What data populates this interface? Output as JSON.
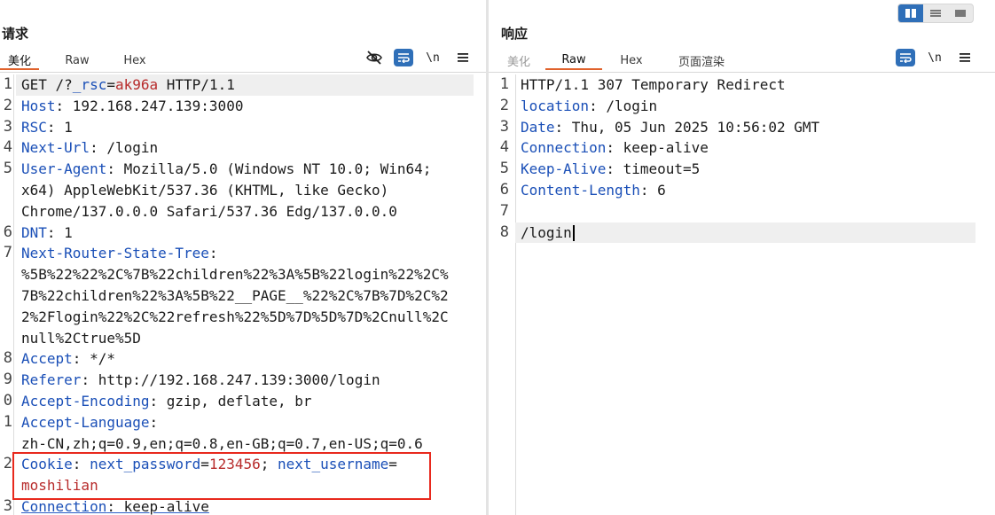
{
  "view_toggle": {
    "modes": [
      "split-columns",
      "split-rows",
      "single"
    ],
    "active": "split-columns"
  },
  "request": {
    "title": "请求",
    "tabs": [
      {
        "label": "美化",
        "active": true
      },
      {
        "label": "Raw",
        "active": false
      },
      {
        "label": "Hex",
        "active": false
      }
    ],
    "toolbar": {
      "hide_icon": "eye-off-icon",
      "wrap_icon": "wrap-icon",
      "newline_label": "\\n",
      "menu_icon": "menu-icon"
    },
    "rows": [
      {
        "no": "1",
        "hl": true,
        "parts": [
          {
            "t": "GET /?",
            "c": "v"
          },
          {
            "t": "_rsc",
            "c": "k"
          },
          {
            "t": "=",
            "c": "v"
          },
          {
            "t": "ak96a",
            "c": "r"
          },
          {
            "t": " HTTP/1.1",
            "c": "v"
          }
        ]
      },
      {
        "no": "2",
        "parts": [
          {
            "t": "Host",
            "c": "k"
          },
          {
            "t": ": 192.168.247.139:3000",
            "c": "v"
          }
        ]
      },
      {
        "no": "3",
        "parts": [
          {
            "t": "RSC",
            "c": "k"
          },
          {
            "t": ": 1",
            "c": "v"
          }
        ]
      },
      {
        "no": "4",
        "parts": [
          {
            "t": "Next-Url",
            "c": "k"
          },
          {
            "t": ": /login",
            "c": "v"
          }
        ]
      },
      {
        "no": "5",
        "parts": [
          {
            "t": "User-Agent",
            "c": "k"
          },
          {
            "t": ": Mozilla/5.0 (Windows NT 10.0; Win64;",
            "c": "v"
          }
        ]
      },
      {
        "no": "",
        "parts": [
          {
            "t": "x64) AppleWebKit/537.36 (KHTML, like Gecko)",
            "c": "v"
          }
        ]
      },
      {
        "no": "",
        "parts": [
          {
            "t": "Chrome/137.0.0.0 Safari/537.36 Edg/137.0.0.0",
            "c": "v"
          }
        ]
      },
      {
        "no": "6",
        "parts": [
          {
            "t": "DNT",
            "c": "k"
          },
          {
            "t": ": 1",
            "c": "v"
          }
        ]
      },
      {
        "no": "7",
        "parts": [
          {
            "t": "Next-Router-State-Tree",
            "c": "k"
          },
          {
            "t": ":",
            "c": "v"
          }
        ]
      },
      {
        "no": "",
        "parts": [
          {
            "t": "%5B%22%22%2C%7B%22children%22%3A%5B%22login%22%2C%",
            "c": "v"
          }
        ]
      },
      {
        "no": "",
        "parts": [
          {
            "t": "7B%22children%22%3A%5B%22__PAGE__%22%2C%7B%7D%2C%2",
            "c": "v"
          }
        ]
      },
      {
        "no": "",
        "parts": [
          {
            "t": "2%2Flogin%22%2C%22refresh%22%5D%7D%5D%7D%2Cnull%2C",
            "c": "v"
          }
        ]
      },
      {
        "no": "",
        "parts": [
          {
            "t": "null%2Ctrue%5D",
            "c": "v"
          }
        ]
      },
      {
        "no": "8",
        "parts": [
          {
            "t": "Accept",
            "c": "k"
          },
          {
            "t": ": */*",
            "c": "v"
          }
        ]
      },
      {
        "no": "9",
        "parts": [
          {
            "t": "Referer",
            "c": "k"
          },
          {
            "t": ": http://192.168.247.139:3000/login",
            "c": "v"
          }
        ]
      },
      {
        "no": "0",
        "parts": [
          {
            "t": "Accept-Encoding",
            "c": "k"
          },
          {
            "t": ": gzip, deflate, br",
            "c": "v"
          }
        ]
      },
      {
        "no": "1",
        "parts": [
          {
            "t": "Accept-Language",
            "c": "k"
          },
          {
            "t": ":",
            "c": "v"
          }
        ]
      },
      {
        "no": "",
        "parts": [
          {
            "t": "zh-CN,zh;q=0.9,en;q=0.8,en-GB;q=0.7,en-US;q=0.6",
            "c": "v"
          }
        ]
      },
      {
        "no": "2",
        "parts": [
          {
            "t": "Cookie",
            "c": "k"
          },
          {
            "t": ": ",
            "c": "v"
          },
          {
            "t": "next_password",
            "c": "k"
          },
          {
            "t": "=",
            "c": "v"
          },
          {
            "t": "123456",
            "c": "r"
          },
          {
            "t": "; ",
            "c": "v"
          },
          {
            "t": "next_username",
            "c": "k"
          },
          {
            "t": "=",
            "c": "v"
          }
        ]
      },
      {
        "no": "",
        "parts": [
          {
            "t": "moshilian",
            "c": "r"
          }
        ]
      },
      {
        "no": "3",
        "parts": [
          {
            "t": "Connection",
            "c": "k u"
          },
          {
            "t": ": keep-alive",
            "c": "v u"
          }
        ]
      }
    ]
  },
  "response": {
    "title": "响应",
    "tabs": [
      {
        "label": "美化",
        "active": false,
        "muted": true
      },
      {
        "label": "Raw",
        "active": true
      },
      {
        "label": "Hex",
        "active": false
      },
      {
        "label": "页面渲染",
        "active": false
      }
    ],
    "toolbar": {
      "wrap_icon": "wrap-icon",
      "newline_label": "\\n",
      "menu_icon": "menu-icon"
    },
    "rows": [
      {
        "no": "1",
        "parts": [
          {
            "t": "HTTP/1.1 307 Temporary Redirect",
            "c": "v"
          }
        ]
      },
      {
        "no": "2",
        "parts": [
          {
            "t": "location",
            "c": "k"
          },
          {
            "t": ": /login",
            "c": "v"
          }
        ]
      },
      {
        "no": "3",
        "parts": [
          {
            "t": "Date",
            "c": "k"
          },
          {
            "t": ": Thu, 05 Jun 2025 10:56:02 GMT",
            "c": "v"
          }
        ]
      },
      {
        "no": "4",
        "parts": [
          {
            "t": "Connection",
            "c": "k"
          },
          {
            "t": ": keep-alive",
            "c": "v"
          }
        ]
      },
      {
        "no": "5",
        "parts": [
          {
            "t": "Keep-Alive",
            "c": "k"
          },
          {
            "t": ": timeout=5",
            "c": "v"
          }
        ]
      },
      {
        "no": "6",
        "parts": [
          {
            "t": "Content-Length",
            "c": "k"
          },
          {
            "t": ": 6",
            "c": "v"
          }
        ]
      },
      {
        "no": "7",
        "parts": []
      },
      {
        "no": "8",
        "hl": true,
        "cursor": true,
        "parts": [
          {
            "t": "/login",
            "c": "v"
          }
        ]
      }
    ]
  },
  "highlight_box": {
    "color": "#e8291d",
    "target": "request Cookie header"
  },
  "colors": {
    "accent": "#2f6fb8",
    "tab_underline": "#e0622c",
    "header_name": "#1a4fb7",
    "value_red": "#b72b2b"
  }
}
